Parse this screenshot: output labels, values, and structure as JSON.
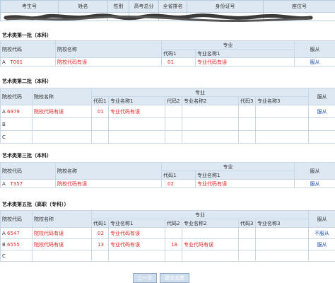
{
  "header": {
    "cols": [
      "考生号",
      "姓名",
      "性别",
      "高考总分",
      "全省排名",
      "身份证号",
      "座位号"
    ]
  },
  "sections": [
    {
      "title": "艺术类第一批（本科）",
      "labels": {
        "school_code": "院校代码",
        "school_name": "院校名称",
        "major": "专业",
        "code1": "代码1",
        "name1": "专业名称1",
        "obey": "服从"
      },
      "rows": [
        {
          "letter": "A",
          "code": "T001",
          "name": "院校代码有误",
          "mcode": "01",
          "mname": "专业代码有误",
          "obey": "服从"
        }
      ]
    },
    {
      "title": "艺术类第二批（本科）",
      "labels": {
        "school_code": "院校代码",
        "school_name": "院校名称",
        "major": "专业",
        "code1": "代码1",
        "name1": "专业名称1",
        "code2": "代码2",
        "name2": "专业名称2",
        "code3": "代码3",
        "name3": "专业名称3",
        "obey": "服从"
      },
      "rows": [
        {
          "letter": "A",
          "code": "6979",
          "name": "院校代码有误",
          "mcode": "01",
          "mname": "专业代码有误",
          "obey": "服从"
        },
        {
          "letter": "B"
        },
        {
          "letter": "C"
        }
      ]
    },
    {
      "title": "艺术类第三批（本科）",
      "labels": {
        "school_code": "院校代码",
        "school_name": "院校名称",
        "major": "专业",
        "code1": "代码1",
        "name1": "专业名称1",
        "obey": "服从"
      },
      "rows": [
        {
          "letter": "A",
          "code": "T357",
          "name": "院校代码有误",
          "mcode": "02",
          "mname": "专业代码有误",
          "obey": "服从"
        }
      ]
    },
    {
      "title": "艺术类第五批（高职（专科））",
      "labels": {
        "school_code": "院校代码",
        "school_name": "院校名称",
        "major": "专业",
        "code1": "代码1",
        "name1": "专业名称1",
        "code2": "代码2",
        "name2": "专业名称2",
        "code3": "代码3",
        "name3": "专业名称3",
        "obey": "服从"
      },
      "rows": [
        {
          "letter": "A",
          "code": "6547",
          "name": "院校代码有误",
          "mcode": "02",
          "mname": "专业代码有误",
          "obey": "不服从"
        },
        {
          "letter": "B",
          "code": "6555",
          "name": "院校代码有误",
          "mcode": "13",
          "mname": "专业代码有误",
          "mcode2": "18",
          "mname2": "专业代码有误",
          "obey": "服从"
        },
        {
          "letter": "C"
        }
      ]
    }
  ],
  "buttons": {
    "prev": "上一步",
    "next": "提交志愿"
  },
  "colors": {
    "header_bg": "#dde8f3",
    "border": "#c9d8e6",
    "error_red": "#e0282a",
    "link_blue": "#1a4fb3"
  }
}
